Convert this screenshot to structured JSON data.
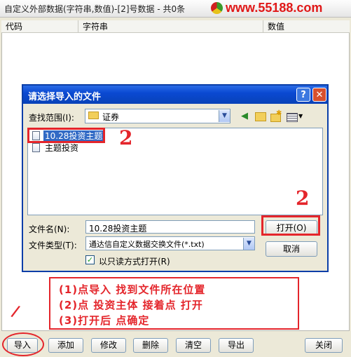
{
  "window": {
    "title": "自定义外部数据(字符串,数值)-[2]号数据 - 共0条",
    "watermark": "www.55188.com"
  },
  "table": {
    "columns": [
      "代码",
      "字符串",
      "数值"
    ]
  },
  "buttons": {
    "import": "导入",
    "add": "添加",
    "modify": "修改",
    "delete": "删除",
    "clear": "清空",
    "export": "导出",
    "close": "关闭"
  },
  "dialog": {
    "title": "请选择导入的文件",
    "help_label": "?",
    "close_label": "✕",
    "look_in_label": "查找范围(I):",
    "look_in_value": "证券",
    "files": [
      "10.28投资主题",
      "主题投资"
    ],
    "filename_label": "文件名(N):",
    "filename_value": "10.28投资主题",
    "filetype_label": "文件类型(T):",
    "filetype_value": "通达信自定义数据交换文件(*.txt)",
    "readonly_label": "以只读方式打开(R)",
    "readonly_checked": true,
    "open_label": "打开(O)",
    "cancel_label": "取消"
  },
  "annotation": {
    "step1": "(1)点导入  找到文件所在位置",
    "step2": "(2)点 投资主体   接着点 打开",
    "step3": "(3)打开后     点确定",
    "mark_one": "/",
    "mark_two_a": "2",
    "mark_two_b": "2"
  },
  "colors": {
    "annotation_red": "#e4252b",
    "dialog_title_blue": "#0a49d2",
    "selection_blue": "#316ac5"
  }
}
